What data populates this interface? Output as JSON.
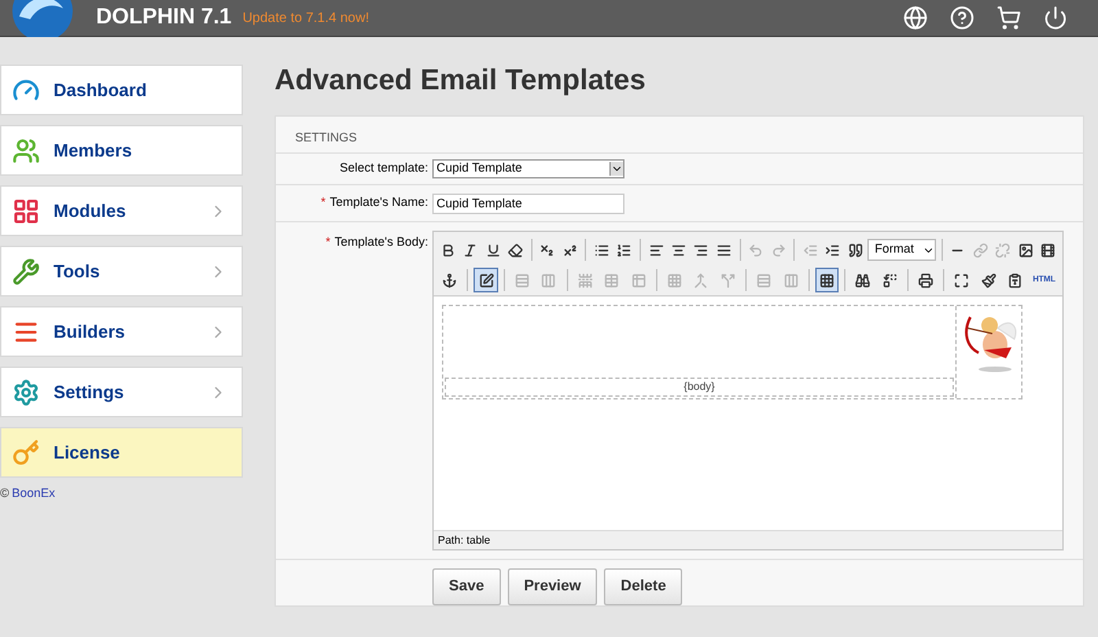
{
  "header": {
    "brand": "DOLPHIN 7.1",
    "update_link": "Update to 7.1.4 now!"
  },
  "sidebar": {
    "items": [
      {
        "label": "Dashboard",
        "color": "#1a8fd1",
        "expandable": false,
        "selected": false
      },
      {
        "label": "Members",
        "color": "#5cb531",
        "expandable": false,
        "selected": false
      },
      {
        "label": "Modules",
        "color": "#e0304a",
        "expandable": true,
        "selected": false
      },
      {
        "label": "Tools",
        "color": "#4a9a2a",
        "expandable": true,
        "selected": false
      },
      {
        "label": "Builders",
        "color": "#e8452a",
        "expandable": true,
        "selected": false
      },
      {
        "label": "Settings",
        "color": "#1f9aa0",
        "expandable": true,
        "selected": false
      },
      {
        "label": "License",
        "color": "#f0a020",
        "expandable": false,
        "selected": true
      }
    ],
    "copyright": "©",
    "copyright_link": "BoonEx"
  },
  "page_title": "Advanced Email Templates",
  "form": {
    "section": "SETTINGS",
    "select_template": {
      "label": "Select template:",
      "value": "Cupid Template"
    },
    "name": {
      "label": "Template's Name:",
      "value": "Cupid Template",
      "required_mark": "*"
    },
    "body": {
      "label": "Template's Body:",
      "required_mark": "*",
      "toolbar_rows": [
        [
          {
            "kind": "button",
            "disabled": false,
            "pressed": false
          },
          {
            "kind": "button",
            "disabled": false,
            "pressed": false
          },
          {
            "kind": "button",
            "disabled": false,
            "pressed": false
          },
          {
            "kind": "button",
            "disabled": false,
            "pressed": false
          },
          {
            "kind": "sep"
          },
          {
            "kind": "button",
            "disabled": false,
            "pressed": false
          },
          {
            "kind": "button",
            "disabled": false,
            "pressed": false
          },
          {
            "kind": "sep"
          },
          {
            "kind": "button",
            "disabled": false,
            "pressed": false
          },
          {
            "kind": "button",
            "disabled": false,
            "pressed": false
          },
          {
            "kind": "sep"
          },
          {
            "kind": "button",
            "disabled": false,
            "pressed": false
          },
          {
            "kind": "button",
            "disabled": false,
            "pressed": false
          },
          {
            "kind": "button",
            "disabled": false,
            "pressed": false
          },
          {
            "kind": "button",
            "disabled": false,
            "pressed": false
          },
          {
            "kind": "sep"
          },
          {
            "kind": "button",
            "disabled": true,
            "pressed": false
          },
          {
            "kind": "button",
            "disabled": true,
            "pressed": false
          },
          {
            "kind": "sep"
          },
          {
            "kind": "button",
            "disabled": true,
            "pressed": false
          },
          {
            "kind": "button",
            "disabled": false,
            "pressed": false
          },
          {
            "kind": "button",
            "disabled": false,
            "pressed": false
          },
          {
            "kind": "select",
            "value": "Format"
          },
          {
            "kind": "sep"
          },
          {
            "kind": "button",
            "disabled": false,
            "pressed": false
          },
          {
            "kind": "button",
            "disabled": true,
            "pressed": false
          },
          {
            "kind": "button",
            "disabled": true,
            "pressed": false
          },
          {
            "kind": "button",
            "disabled": false,
            "pressed": false
          },
          {
            "kind": "button",
            "disabled": false,
            "pressed": false
          }
        ],
        [
          {
            "kind": "button",
            "disabled": false,
            "pressed": false
          },
          {
            "kind": "sep"
          },
          {
            "kind": "button",
            "disabled": false,
            "pressed": true
          },
          {
            "kind": "sep"
          },
          {
            "kind": "button",
            "disabled": true,
            "pressed": false
          },
          {
            "kind": "button",
            "disabled": true,
            "pressed": false
          },
          {
            "kind": "sep"
          },
          {
            "kind": "button",
            "disabled": true,
            "pressed": false
          },
          {
            "kind": "button",
            "disabled": true,
            "pressed": false
          },
          {
            "kind": "button",
            "disabled": true,
            "pressed": false
          },
          {
            "kind": "sep"
          },
          {
            "kind": "button",
            "disabled": true,
            "pressed": false
          },
          {
            "kind": "button",
            "disabled": true,
            "pressed": false
          },
          {
            "kind": "button",
            "disabled": true,
            "pressed": false
          },
          {
            "kind": "sep"
          },
          {
            "kind": "button",
            "disabled": true,
            "pressed": false
          },
          {
            "kind": "button",
            "disabled": true,
            "pressed": false
          },
          {
            "kind": "sep"
          },
          {
            "kind": "button",
            "disabled": false,
            "pressed": true
          },
          {
            "kind": "sep"
          },
          {
            "kind": "button",
            "disabled": false,
            "pressed": false
          },
          {
            "kind": "button",
            "disabled": false,
            "pressed": false
          },
          {
            "kind": "sep"
          },
          {
            "kind": "button",
            "disabled": false,
            "pressed": false
          },
          {
            "kind": "sep"
          },
          {
            "kind": "button",
            "disabled": false,
            "pressed": false
          },
          {
            "kind": "button",
            "disabled": false,
            "pressed": false
          },
          {
            "kind": "button",
            "disabled": false,
            "pressed": false
          },
          {
            "kind": "text",
            "label": "HTML"
          }
        ]
      ],
      "content_placeholder": "{body}",
      "path": "Path: table"
    },
    "buttons": [
      "Save",
      "Preview",
      "Delete"
    ]
  }
}
